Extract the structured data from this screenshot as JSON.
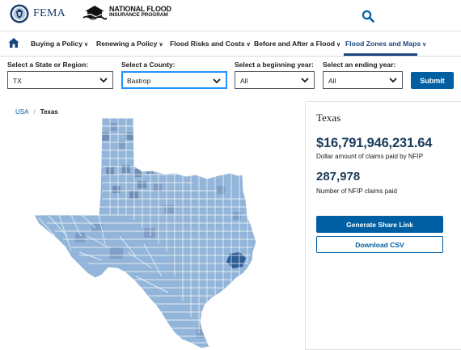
{
  "header": {
    "fema_logo_text": "FEMA",
    "nfip_logo_line1": "NATIONAL FLOOD",
    "nfip_logo_line2": "INSURANCE PROGRAM",
    "icons": [
      "dhs-seal-icon",
      "nfip-house-logo-icon",
      "search-icon"
    ]
  },
  "nav": {
    "home_icon": "home-icon",
    "items": [
      {
        "label": "Buying a Policy"
      },
      {
        "label": "Renewing a Policy"
      },
      {
        "label": "Flood Risks and Costs"
      },
      {
        "label": "Before and After a Flood"
      },
      {
        "label": "Flood Zones and Maps",
        "active": true
      }
    ]
  },
  "filters": {
    "state": {
      "label": "Select a State or Region:",
      "value": "TX"
    },
    "county": {
      "label": "Select a County:",
      "value": "Bastrop"
    },
    "begin_year": {
      "label": "Select a beginning year:",
      "value": "All"
    },
    "end_year": {
      "label": "Select an ending year:",
      "value": "All"
    },
    "submit_label": "Submit"
  },
  "breadcrumb": {
    "root": "USA",
    "separator": "/",
    "current": "Texas"
  },
  "stats": {
    "region": "Texas",
    "amount": "$16,791,946,231.64",
    "amount_label": "Dollar amount of claims paid by NFIP",
    "count": "287,978",
    "count_label": "Number of NFIP claims paid",
    "share_label": "Generate Share Link",
    "csv_label": "Download CSV"
  },
  "colors": {
    "primary": "#005ea2",
    "nav_active": "#1a4480",
    "stat_text": "#1a3b5c",
    "focus_ring": "#2491ff",
    "map_fill": "#93b5d9",
    "map_fill_mid": "#7f9fc6",
    "map_fill_dark": "#6a88ad",
    "map_highlight": "#2c5d94"
  }
}
